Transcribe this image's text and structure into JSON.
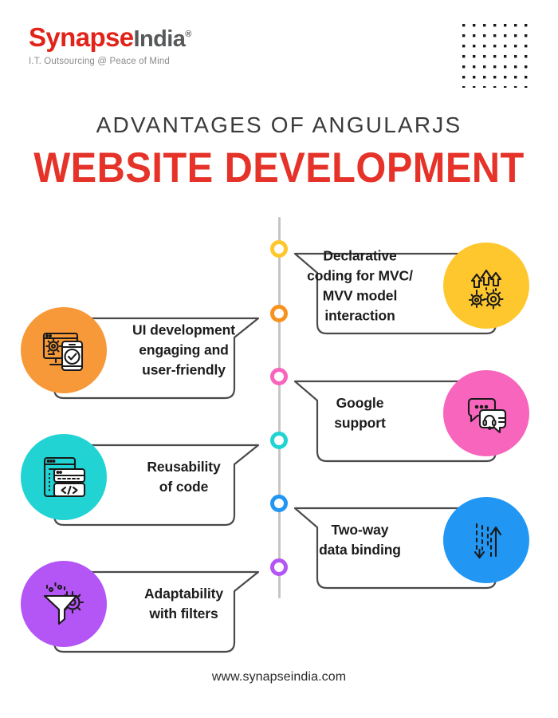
{
  "brand": {
    "logo_primary": "Synapse",
    "logo_secondary": "India",
    "logo_registered": "®",
    "tagline": "I.T. Outsourcing @ Peace of Mind",
    "primary_color": "#e2231a",
    "secondary_color": "#58595b"
  },
  "header": {
    "eyebrow": "ADVANTAGES OF ANGULARJS",
    "title": "WEBSITE DEVELOPMENT",
    "title_color": "#e63329",
    "eyebrow_color": "#3b3b3b"
  },
  "decor": {
    "dot_grid_name": "dot-grid-decoration",
    "dot_grid_rows": 7,
    "dot_grid_cols": 7,
    "dot_color": "#1a1a1a",
    "timeline_line_color": "#c8c4c4"
  },
  "items": [
    {
      "id": "declarative-coding",
      "side": "right",
      "text": "Declarative\ncoding for MVC/\nMVV model interaction",
      "color": "#ffc72e",
      "icon": "gears-up-arrows-icon",
      "dot_color": "#ffc72e"
    },
    {
      "id": "ui-development",
      "side": "left",
      "text": "UI development\nengaging and\nuser-friendly",
      "color": "#f79839",
      "icon": "monitor-gear-mobile-check-icon",
      "dot_color": "#f7921e"
    },
    {
      "id": "google-support",
      "side": "right",
      "text": "Google\nsupport",
      "color": "#f765bc",
      "icon": "chat-bubbles-headset-icon",
      "dot_color": "#f765bc"
    },
    {
      "id": "reusability-of-code",
      "side": "left",
      "text": "Reusability\nof code",
      "color": "#22d3d3",
      "icon": "stacked-code-windows-icon",
      "dot_color": "#22d3d3"
    },
    {
      "id": "two-way-data-binding",
      "side": "right",
      "text": "Two-way\ndata binding",
      "color": "#2196f3",
      "icon": "two-way-arrows-icon",
      "dot_color": "#2196f3"
    },
    {
      "id": "adaptability-with-filters",
      "side": "left",
      "text": "Adaptability\nwith filters",
      "color": "#b455f5",
      "icon": "funnel-gear-filter-icon",
      "dot_color": "#b455f5"
    }
  ],
  "footer": {
    "url": "www.synapseindia.com"
  }
}
